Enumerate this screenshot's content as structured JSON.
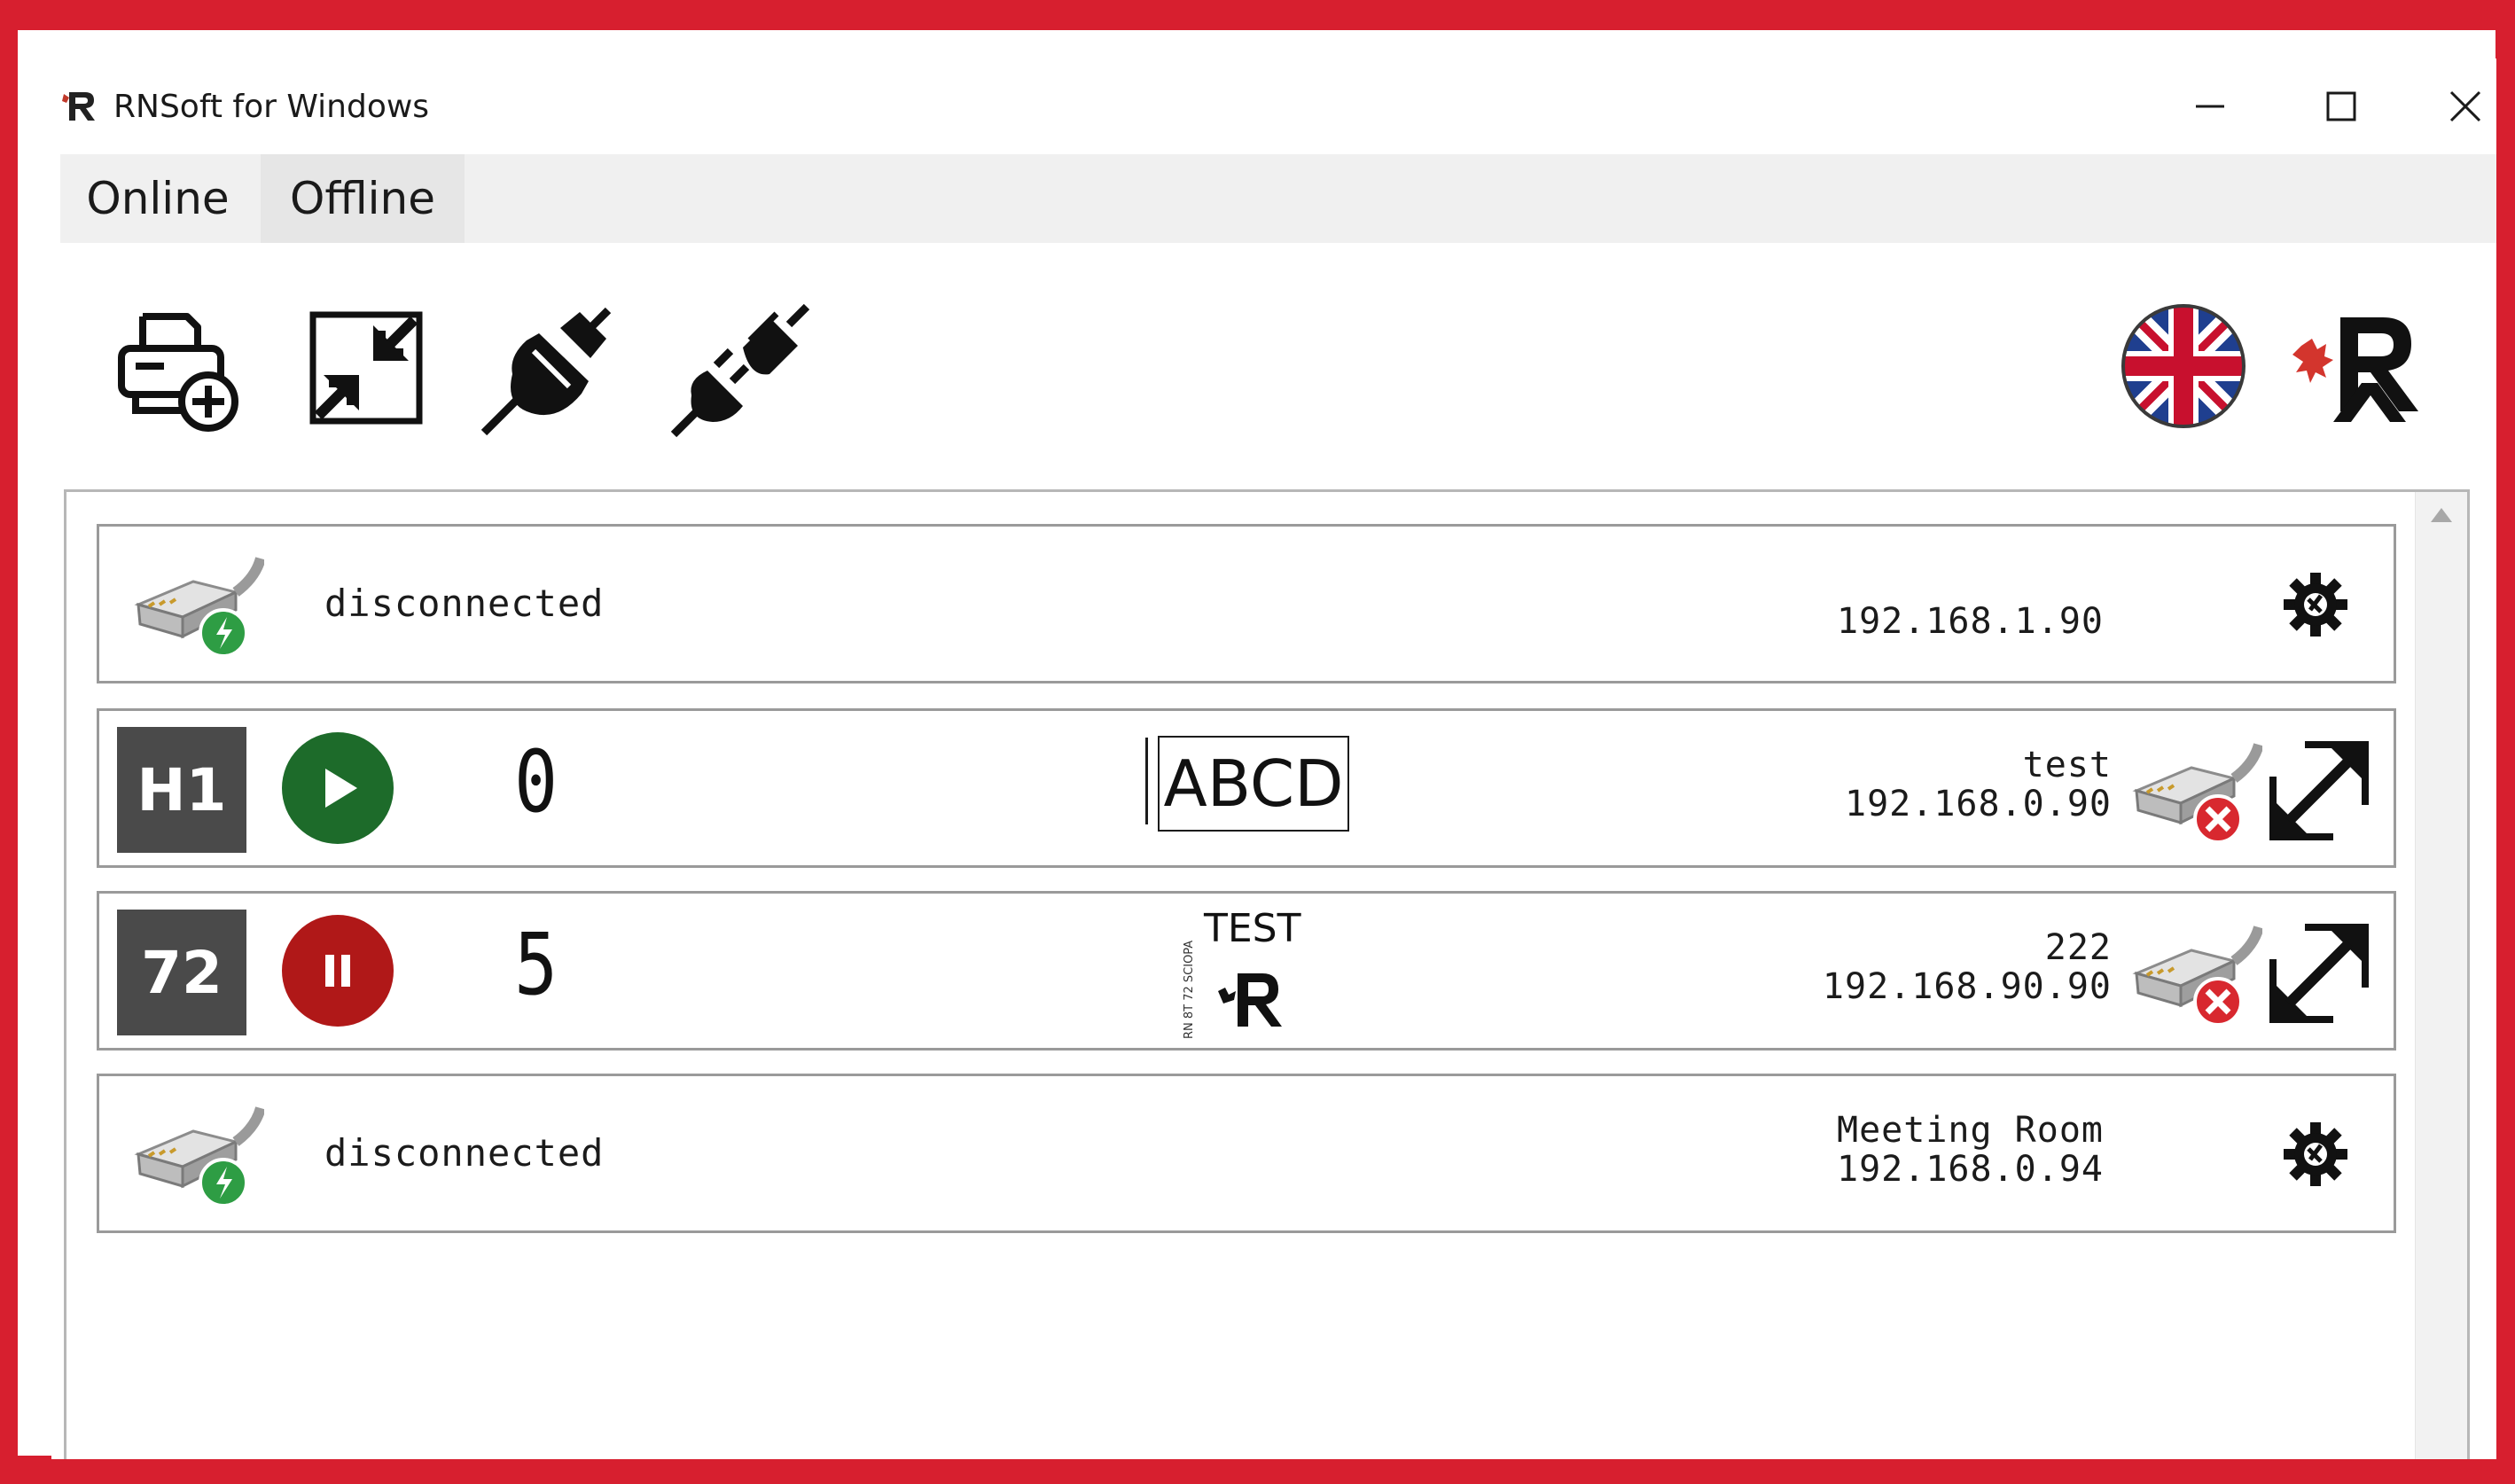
{
  "window": {
    "title": "RNSoft for Windows",
    "controls": [
      "minimize",
      "maximize",
      "close"
    ]
  },
  "tabs": [
    {
      "label": "Online",
      "active": true
    },
    {
      "label": "Offline",
      "active": false
    }
  ],
  "toolbar": {
    "icons": [
      "printer-add-icon",
      "collapse-icon",
      "connect-plug-icon",
      "disconnect-plug-icon"
    ],
    "language_flag": "uk-flag-icon",
    "brand_logo": "rn-logo"
  },
  "devices": [
    {
      "state": "disconnected",
      "status_label": "disconnected",
      "name": "",
      "ip": "192.168.1.90",
      "icon": "network-connect-icon"
    },
    {
      "state": "connected",
      "badge": "H1",
      "run_state": "playing",
      "counter": "0",
      "preview_text": "ABCD",
      "name": "test",
      "ip": "192.168.0.90",
      "icon": "network-error-icon"
    },
    {
      "state": "connected",
      "badge": "72",
      "run_state": "paused",
      "counter": "5",
      "preview_text": "TEST",
      "preview_side_text": "RN 8T 72 SCIOPA",
      "name": "222",
      "ip": "192.168.90.90",
      "icon": "network-error-icon"
    },
    {
      "state": "disconnected",
      "status_label": "disconnected",
      "name": "Meeting Room",
      "ip": "192.168.0.94",
      "icon": "network-connect-icon"
    }
  ],
  "colors": {
    "frame": "#d71f2f",
    "play_green": "#1d6b2a",
    "pause_red": "#b01818",
    "badge_gray": "#4a4a4a"
  }
}
